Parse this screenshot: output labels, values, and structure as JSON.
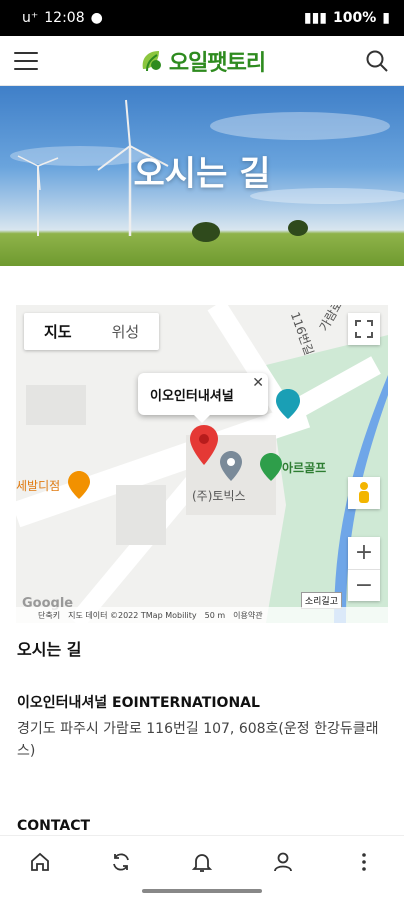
{
  "status_bar": {
    "carrier": "u⁺",
    "time": "12:08",
    "battery": "100%"
  },
  "app_bar": {
    "brand": "오일팻토리",
    "menu_icon": "hamburger-icon",
    "search_icon": "search-icon"
  },
  "hero": {
    "title": "오시는 길"
  },
  "map": {
    "type_tabs": [
      "지도",
      "위성"
    ],
    "info_window": "이오인터내셔널",
    "labels": {
      "tobix": "(주)토빅스",
      "golf": "아르골프",
      "restaurant": "세발디점",
      "road_1": "가람로",
      "road_2": "116번길",
      "road_badge": "소리길고",
      "partial_top": "가람로"
    },
    "footer": {
      "shortcut": "단축키",
      "data": "지도 데이터 ©2022 TMap Mobility",
      "scale": "50 m",
      "terms": "이용약관"
    },
    "google": "Google"
  },
  "content": {
    "section_title": "오시는 길",
    "company": "이오인터내셔널 EOINTERNATIONAL",
    "address": "경기도 파주시 가람로 116번길 107, 608호(운정 한강듀클래스)",
    "contact": "CONTACT"
  },
  "bottom_nav": [
    "home-icon",
    "refresh-icon",
    "bell-icon",
    "user-icon",
    "more-icon"
  ]
}
